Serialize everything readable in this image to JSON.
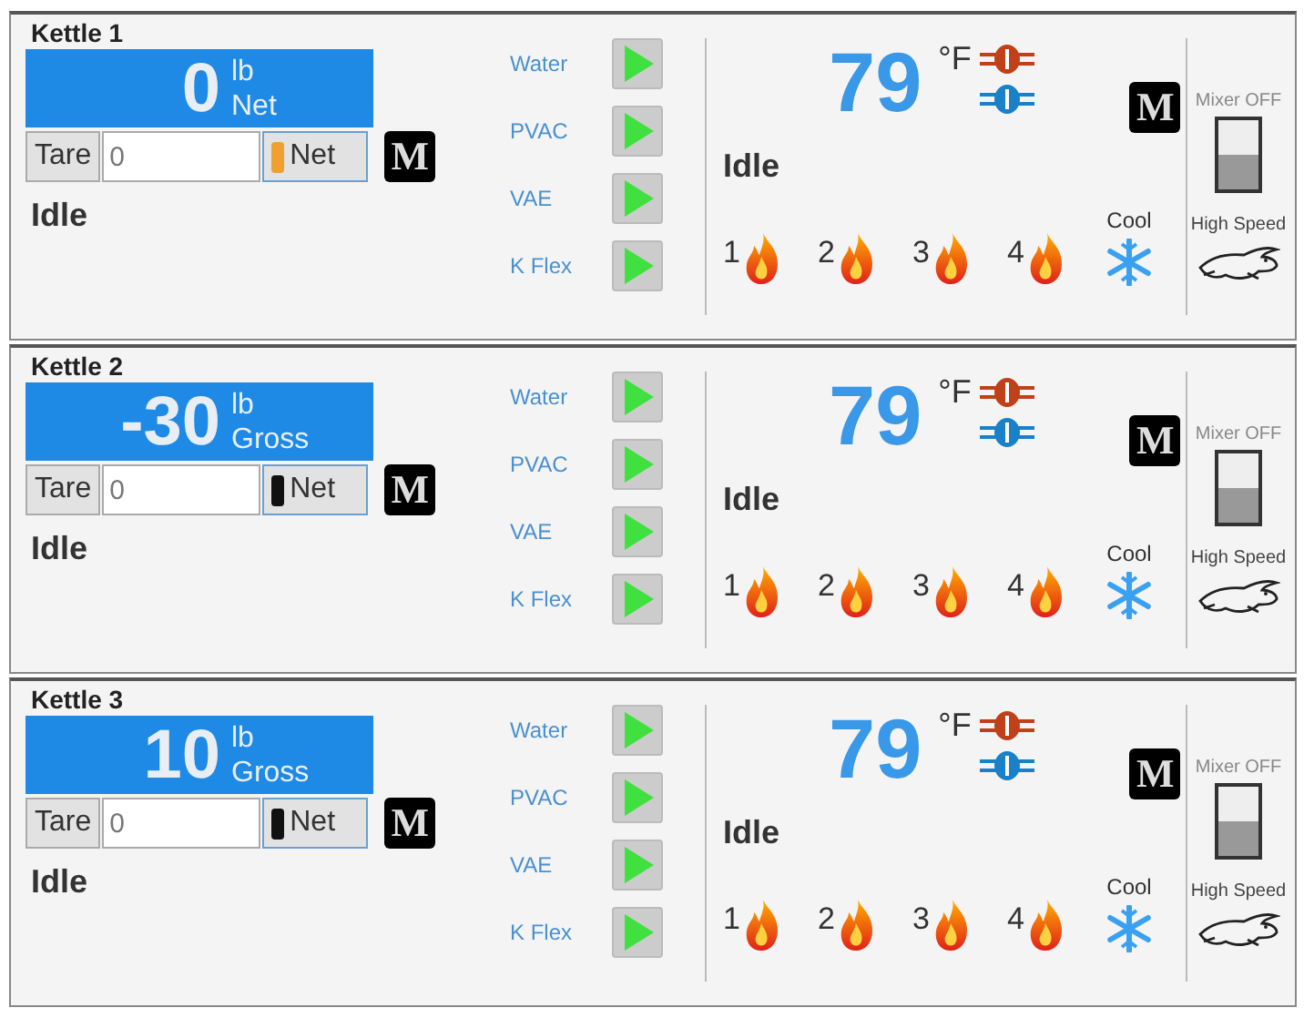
{
  "kettles": [
    {
      "title": "Kettle 1",
      "weight": "0",
      "unit": "lb",
      "mode": "Net",
      "tare": {
        "label": "Tare",
        "value": "0"
      },
      "net_button": {
        "label": "Net",
        "on": true
      },
      "manual": "M",
      "status": "Idle",
      "pumps": [
        {
          "label": "Water"
        },
        {
          "label": "PVAC"
        },
        {
          "label": "VAE"
        },
        {
          "label": "K Flex"
        }
      ],
      "temperature": "79",
      "temp_unit": "°F",
      "heat_status": "Idle",
      "burners": [
        {
          "label": "1"
        },
        {
          "label": "2"
        },
        {
          "label": "3"
        },
        {
          "label": "4"
        }
      ],
      "heat_manual": "M",
      "cool": "Cool",
      "mixer": {
        "label": "Mixer OFF",
        "on": false,
        "speed": "High Speed"
      }
    },
    {
      "title": "Kettle 2",
      "weight": "-30",
      "unit": "lb",
      "mode": "Gross",
      "tare": {
        "label": "Tare",
        "value": "0"
      },
      "net_button": {
        "label": "Net",
        "on": false
      },
      "manual": "M",
      "status": "Idle",
      "pumps": [
        {
          "label": "Water"
        },
        {
          "label": "PVAC"
        },
        {
          "label": "VAE"
        },
        {
          "label": "K Flex"
        }
      ],
      "temperature": "79",
      "temp_unit": "°F",
      "heat_status": "Idle",
      "burners": [
        {
          "label": "1"
        },
        {
          "label": "2"
        },
        {
          "label": "3"
        },
        {
          "label": "4"
        }
      ],
      "heat_manual": "M",
      "cool": "Cool",
      "mixer": {
        "label": "Mixer OFF",
        "on": false,
        "speed": "High Speed"
      }
    },
    {
      "title": "Kettle 3",
      "weight": "10",
      "unit": "lb",
      "mode": "Gross",
      "tare": {
        "label": "Tare",
        "value": "0"
      },
      "net_button": {
        "label": "Net",
        "on": false
      },
      "manual": "M",
      "status": "Idle",
      "pumps": [
        {
          "label": "Water"
        },
        {
          "label": "PVAC"
        },
        {
          "label": "VAE"
        },
        {
          "label": "K Flex"
        }
      ],
      "temperature": "79",
      "temp_unit": "°F",
      "heat_status": "Idle",
      "burners": [
        {
          "label": "1"
        },
        {
          "label": "2"
        },
        {
          "label": "3"
        },
        {
          "label": "4"
        }
      ],
      "heat_manual": "M",
      "cool": "Cool",
      "mixer": {
        "label": "Mixer OFF",
        "on": false,
        "speed": "High Speed"
      }
    }
  ]
}
